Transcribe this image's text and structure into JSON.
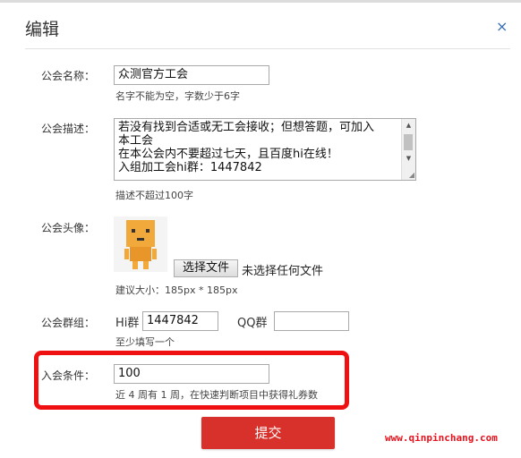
{
  "dialog": {
    "title": "编辑",
    "close_symbol": "×"
  },
  "fields": {
    "name": {
      "label": "公会名称：",
      "value": "众测官方工会",
      "hint": "名字不能为空，字数少于6字"
    },
    "description": {
      "label": "公会描述：",
      "lines": [
        "若没有找到合适或无工会接收；但想答题，可加入",
        "本工会",
        "在本公会内不要超过七天，且百度hi在线！",
        "入组加工会hi群：1447842"
      ],
      "hint": "描述不超过100字"
    },
    "avatar": {
      "label": "公会头像：",
      "file_button": "选择文件",
      "file_status": "未选择任何文件",
      "hint": "建议大小：185px * 185px"
    },
    "groups": {
      "label": "公会群组：",
      "hi_label": "Hi群",
      "hi_value": "1447842",
      "qq_label": "QQ群",
      "qq_value": "",
      "hint": "至少填写一个"
    },
    "condition": {
      "label": "入会条件：",
      "value": "100",
      "hint": "近 4 周有 1 周，在快速判断项目中获得礼券数"
    }
  },
  "submit_label": "提交",
  "watermark": "www.qinpinchang.com",
  "colors": {
    "accent_red": "#d8302a",
    "highlight_red": "#ef1111",
    "close_blue": "#3a6fb7",
    "watermark_red": "#e8101c"
  }
}
